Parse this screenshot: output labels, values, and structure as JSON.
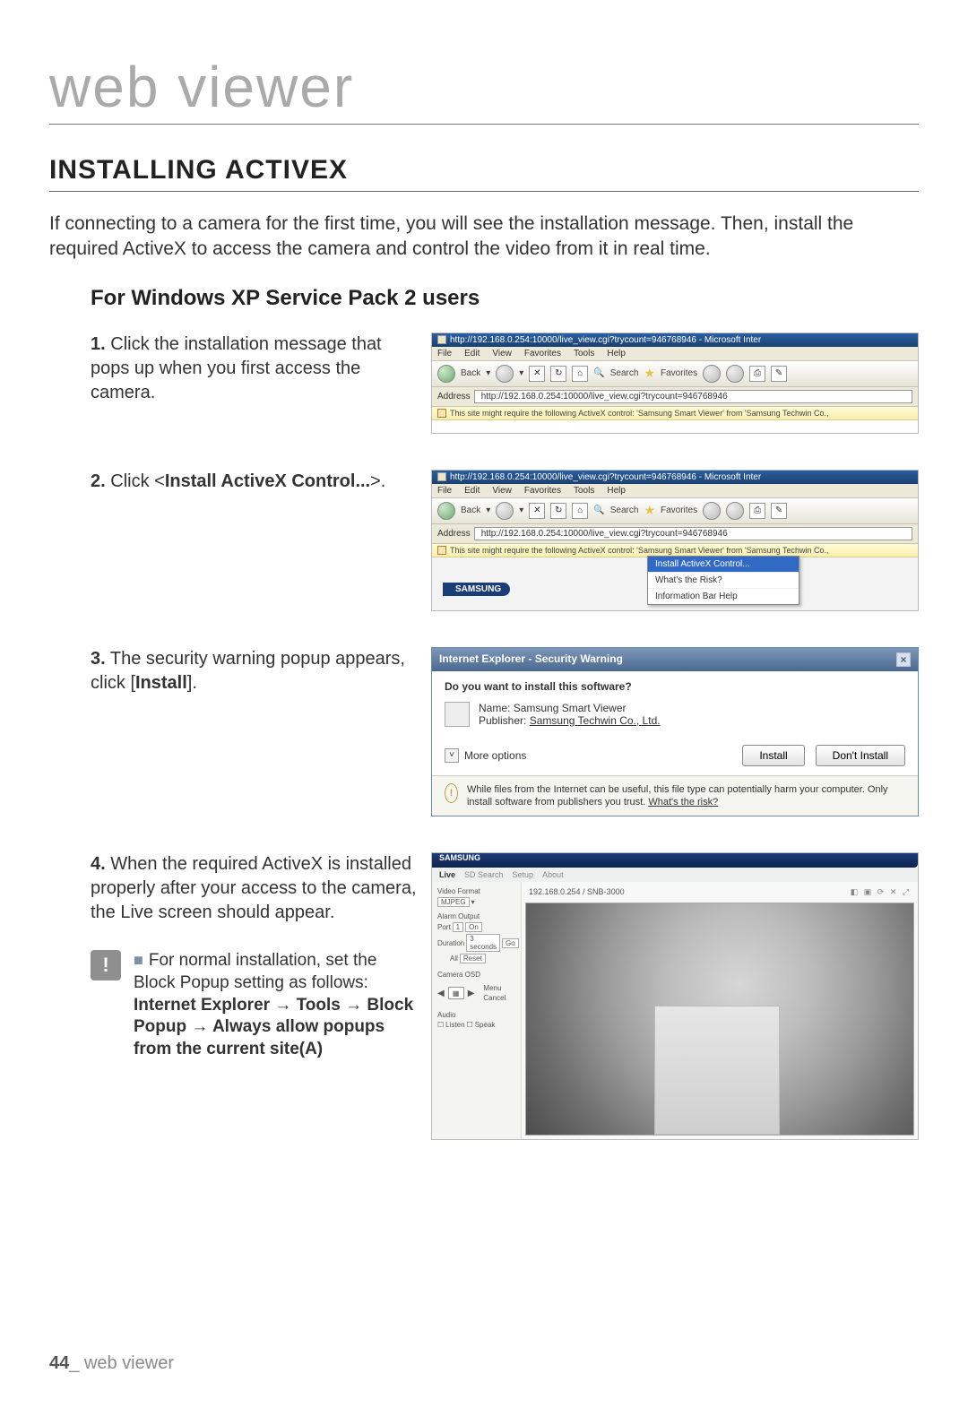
{
  "chapter_title": "web viewer",
  "heading": "INSTALLING ACTIVEX",
  "intro": "If connecting to a camera for the first time, you will see the installation message. Then, install the required ActiveX to access the camera and control the video from it in real time.",
  "subheading": "For Windows XP Service Pack 2 users",
  "steps": {
    "s1_num": "1.",
    "s1_text": " Click the installation message that pops up when you first access the camera.",
    "s2_num": "2.",
    "s2_a": " Click <",
    "s2_bold": "Install ActiveX Control...",
    "s2_b": ">.",
    "s3_num": "3.",
    "s3_a": " The security warning popup appears, click [",
    "s3_bold": "Install",
    "s3_b": "].",
    "s4_num": "4.",
    "s4_text": " When the required ActiveX is installed properly after your access to the camera, the Live screen should appear."
  },
  "note": {
    "lead": "For normal installation, set the Block Popup setting as follows:",
    "path": "Internet Explorer → Tools → Block Popup → Always allow popups from the current site(A)"
  },
  "ie": {
    "title": "http://192.168.0.254:10000/live_view.cgi?trycount=946768946 - Microsoft Inter",
    "menu": {
      "file": "File",
      "edit": "Edit",
      "view": "View",
      "fav": "Favorites",
      "tools": "Tools",
      "help": "Help"
    },
    "back": "Back",
    "search": "Search",
    "favorites": "Favorites",
    "addr_label": "Address",
    "addr_url": "http://192.168.0.254:10000/live_view.cgi?trycount=946768946",
    "infobar": "This site might require the following ActiveX control: 'Samsung Smart Viewer' from 'Samsung Techwin Co.,"
  },
  "ctx": {
    "install": "Install ActiveX Control...",
    "risk": "What's the Risk?",
    "help": "Information Bar Help"
  },
  "samsung": "SAMSUNG",
  "dlg": {
    "title": "Internet Explorer - Security Warning",
    "question": "Do you want to install this software?",
    "name_lbl": "Name:",
    "name_val": "Samsung Smart Viewer",
    "pub_lbl": "Publisher:",
    "pub_val": "Samsung Techwin Co., Ltd.",
    "more": "More options",
    "install": "Install",
    "dont": "Don't Install",
    "warn_a": "While files from the Internet can be useful, this file type can potentially harm your computer. Only install software from publishers you trust. ",
    "warn_link": "What's the risk?"
  },
  "viewer": {
    "tabs": {
      "live": "Live",
      "sd": "SD Search",
      "setup": "Setup",
      "about": "About"
    },
    "ip_model": "192.168.0.254 / SNB-3000",
    "side": {
      "video_format": "Video Format",
      "mjpeg": "MJPEG",
      "alarm_output": "Alarm Output",
      "port": "Port",
      "one": "1",
      "on": "On",
      "duration": "Duration",
      "threes": "3 seconds",
      "go": "Go",
      "all": "All",
      "reset": "Reset",
      "cam_osd": "Camera OSD",
      "menu": "Menu",
      "cancel": "Cancel",
      "audio": "Audio",
      "listen": "Listen",
      "speak": "Speak"
    },
    "righticons": "◧ ▣ ⟳ ✕ ⤢"
  },
  "footer": {
    "page": "44",
    "sep": "_ ",
    "label": "web viewer"
  }
}
